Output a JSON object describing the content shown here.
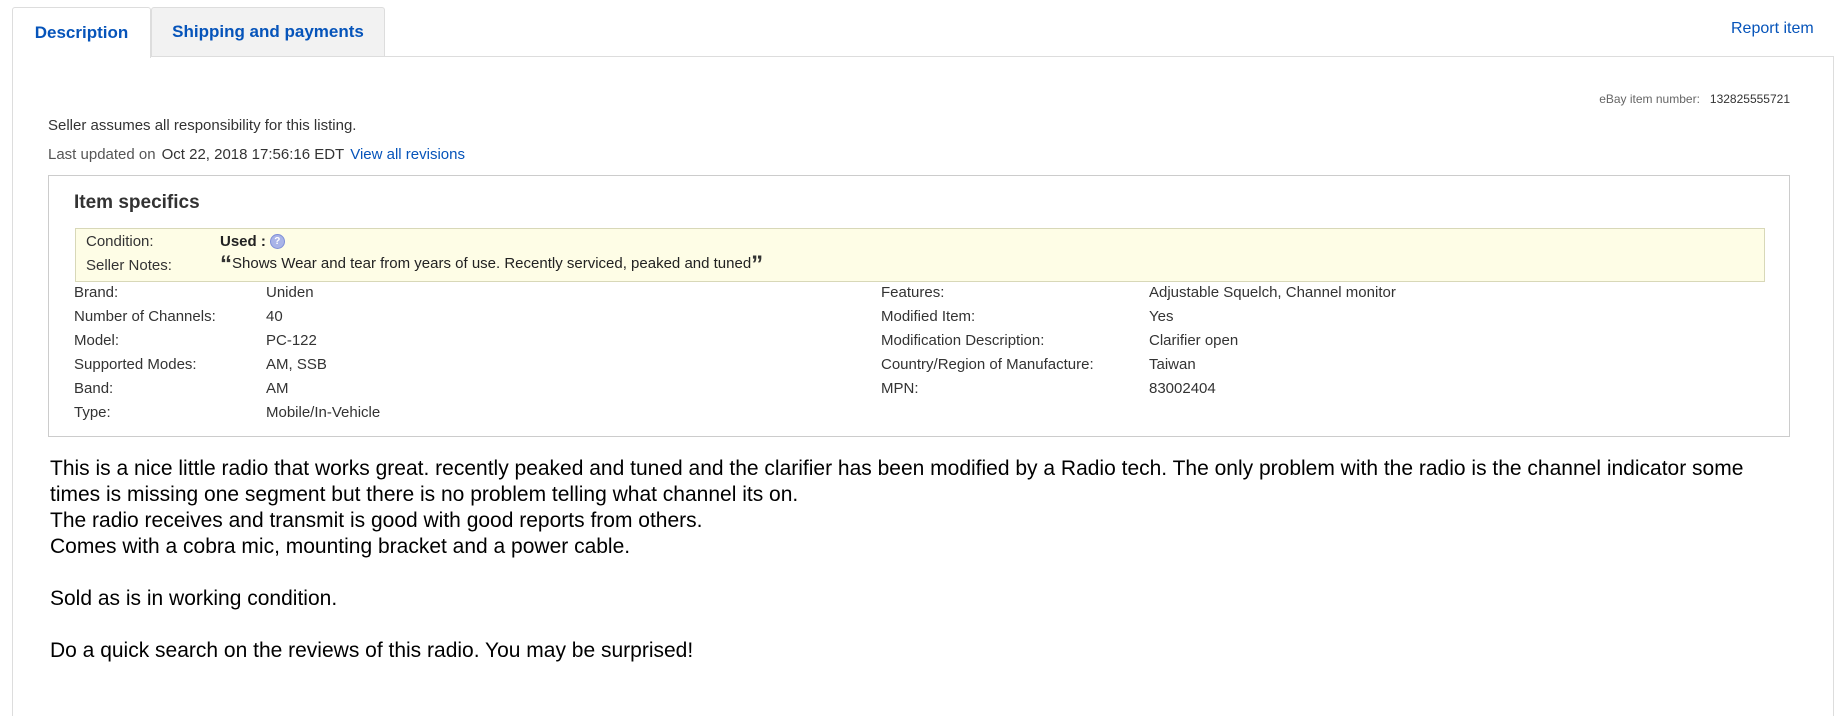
{
  "tabs": {
    "description": "Description",
    "shipping": "Shipping and payments"
  },
  "report_item": "Report item",
  "item_number": {
    "label": "eBay item number:",
    "value": "132825555721"
  },
  "seller_notice": "Seller assumes all responsibility for this listing.",
  "last_updated": {
    "label": "Last updated on",
    "date": "Oct 22, 2018 17:56:16 EDT",
    "link": "View all revisions"
  },
  "specifics": {
    "title": "Item specifics",
    "condition_label": "Condition:",
    "condition_value": "Used :",
    "seller_notes_label": "Seller Notes:",
    "seller_notes_value": "Shows Wear and tear from years of use. Recently serviced, peaked and tuned",
    "left": [
      {
        "label": "Brand:",
        "value": "Uniden"
      },
      {
        "label": "Number of Channels:",
        "value": "40"
      },
      {
        "label": "Model:",
        "value": "PC-122"
      },
      {
        "label": "Supported Modes:",
        "value": "AM, SSB"
      },
      {
        "label": "Band:",
        "value": "AM"
      },
      {
        "label": "Type:",
        "value": "Mobile/In-Vehicle"
      }
    ],
    "right": [
      {
        "label": "Features:",
        "value": "Adjustable Squelch, Channel monitor"
      },
      {
        "label": "Modified Item:",
        "value": "Yes"
      },
      {
        "label": "Modification Description:",
        "value": "Clarifier open"
      },
      {
        "label": "Country/Region of Manufacture:",
        "value": "Taiwan"
      },
      {
        "label": "MPN:",
        "value": "83002404"
      }
    ]
  },
  "description": {
    "p1": "This is a nice little radio that works great. recently peaked and tuned and the clarifier has been modified by a Radio tech. The only problem with the radio is the channel indicator some times is missing one segment but there is no problem telling what channel its on.",
    "p2": "The radio receives and transmit is good with good reports from others.",
    "p3": "Comes with a cobra mic, mounting bracket and a power cable.",
    "p4": "Sold as is in working condition.",
    "p5": "Do a quick search on the reviews of this radio. You may be surprised!"
  }
}
